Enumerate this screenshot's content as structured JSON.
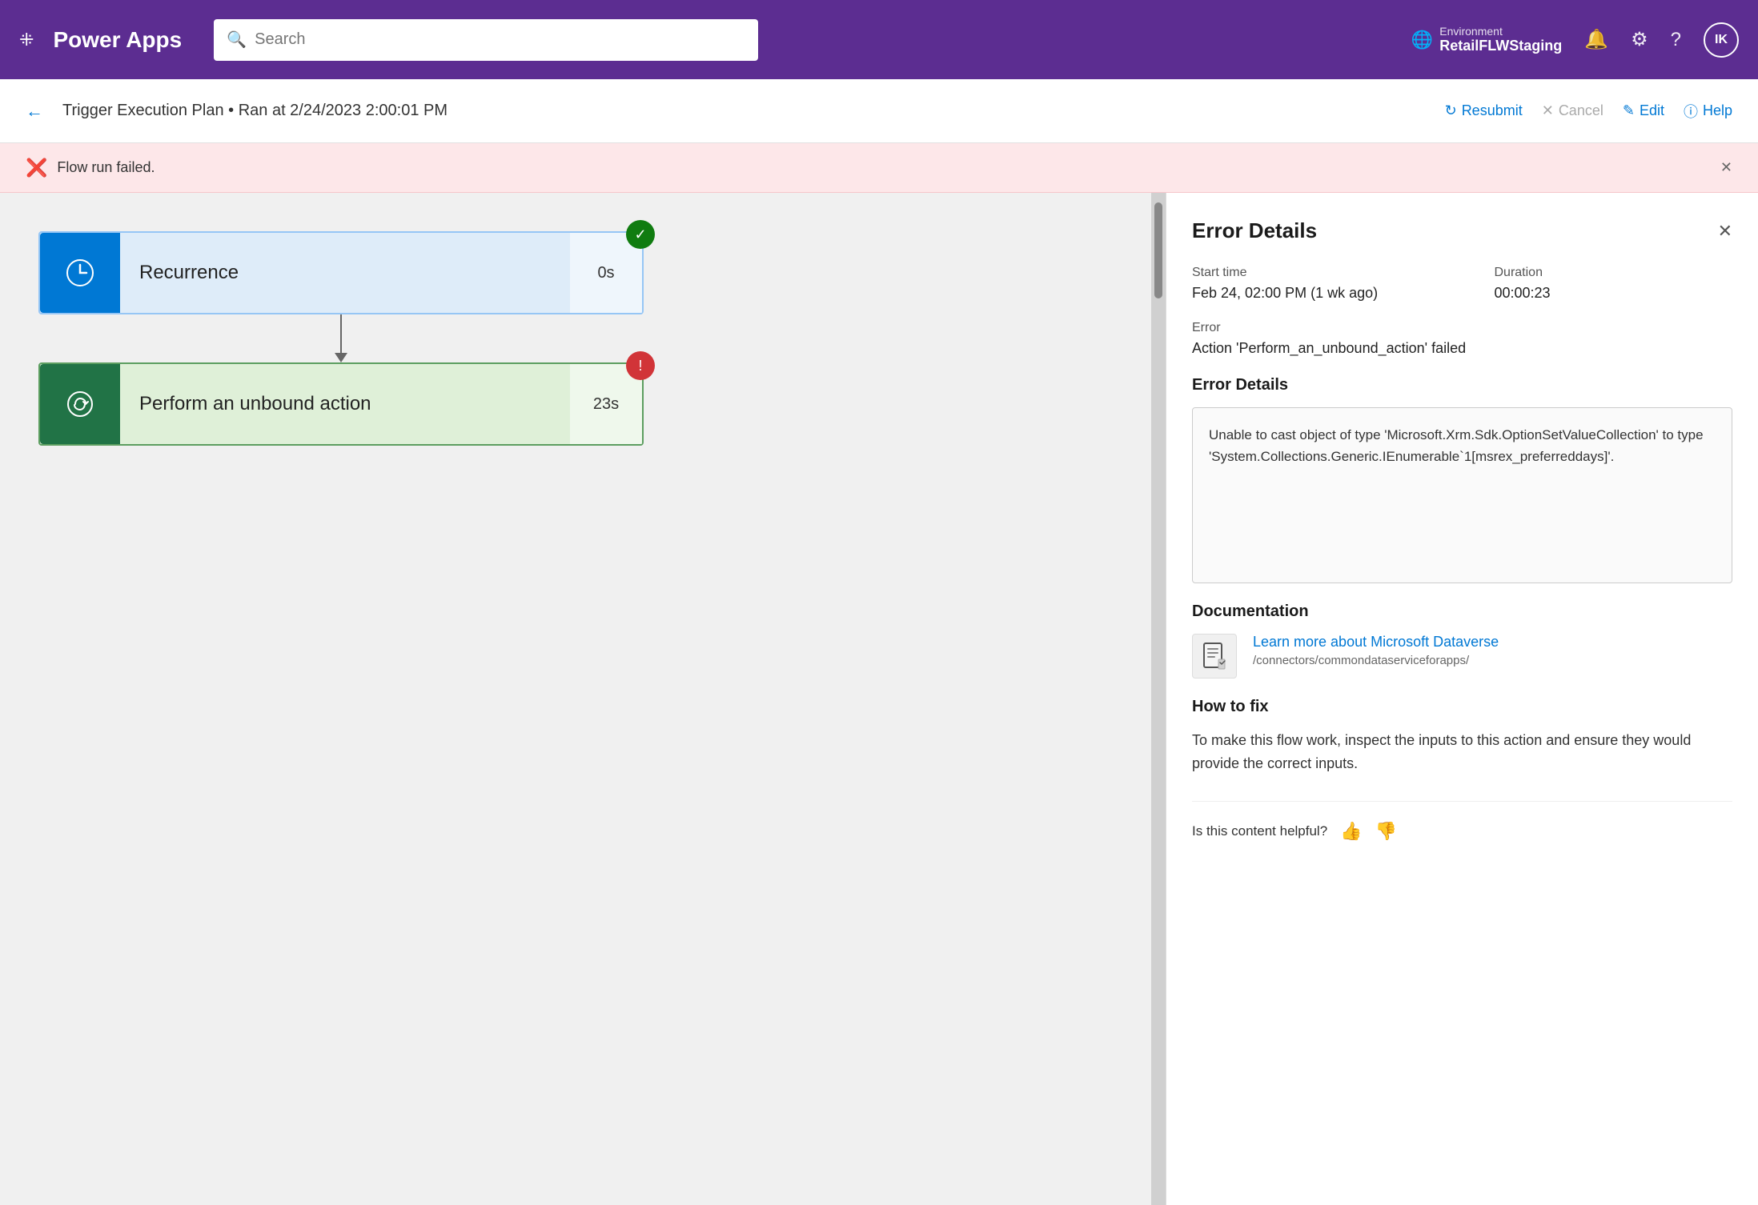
{
  "app": {
    "name": "Power Apps"
  },
  "nav": {
    "search_placeholder": "Search",
    "environment_label": "Environment",
    "environment_name": "RetailFLWStaging",
    "avatar_initials": "IK"
  },
  "subheader": {
    "breadcrumb": "Trigger Execution Plan • Ran at 2/24/2023 2:00:01 PM",
    "resubmit": "Resubmit",
    "cancel": "Cancel",
    "edit": "Edit",
    "help": "Help"
  },
  "error_banner": {
    "message": "Flow run failed."
  },
  "flow_nodes": [
    {
      "id": "recurrence",
      "label": "Recurrence",
      "time": "0s",
      "status": "success"
    },
    {
      "id": "action",
      "label": "Perform an unbound action",
      "time": "23s",
      "status": "error"
    }
  ],
  "error_panel": {
    "title": "Error Details",
    "start_time_label": "Start time",
    "start_time_value": "Feb 24, 02:00 PM (1 wk ago)",
    "duration_label": "Duration",
    "duration_value": "00:00:23",
    "error_label": "Error",
    "error_value": "Action 'Perform_an_unbound_action' failed",
    "error_details_label": "Error Details",
    "error_details_text": "Unable to cast object of type 'Microsoft.Xrm.Sdk.OptionSetValueCollection' to type 'System.Collections.Generic.IEnumerable`1[msrex_preferreddays]'.",
    "documentation_label": "Documentation",
    "doc_link_title": "Learn more about Microsoft Dataverse",
    "doc_link_url": "/connectors/commondataserviceforapps/",
    "how_to_fix_label": "How to fix",
    "how_to_fix_text": "To make this flow work, inspect the inputs to this action and ensure they would provide the correct inputs.",
    "feedback_label": "Is this content helpful?"
  }
}
